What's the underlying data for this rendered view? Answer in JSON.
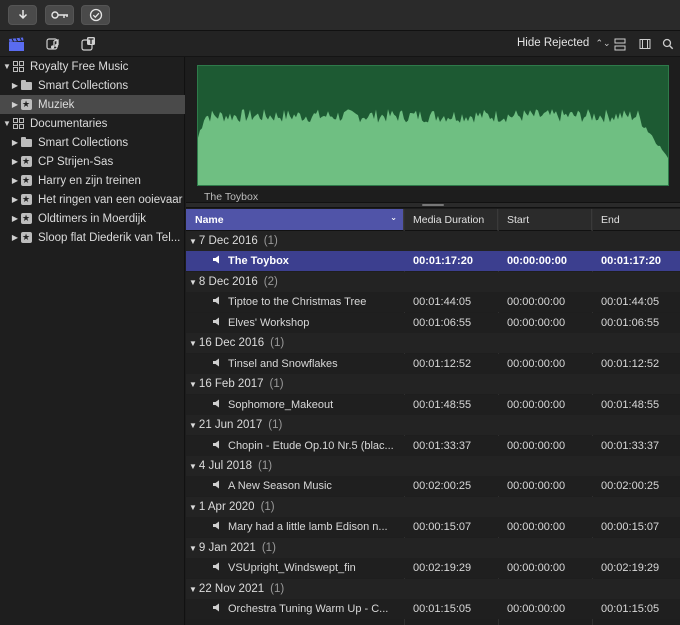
{
  "toolbar": {
    "buttons": [
      {
        "icon": "import-arrow-icon"
      },
      {
        "icon": "key-icon"
      },
      {
        "icon": "checkmark-circle-icon"
      }
    ]
  },
  "header": {
    "filter_label": "Hide Rejected"
  },
  "sidebar": {
    "items": [
      {
        "label": "Royalty Free Music",
        "level": 0,
        "expanded": true,
        "icon": "library-icon"
      },
      {
        "label": "Smart Collections",
        "level": 1,
        "expanded": false,
        "icon": "folder-icon"
      },
      {
        "label": "Muziek",
        "level": 1,
        "expanded": false,
        "icon": "event-star-icon",
        "selected": true
      },
      {
        "label": "Documentaries",
        "level": 0,
        "expanded": true,
        "icon": "library-icon"
      },
      {
        "label": "Smart Collections",
        "level": 1,
        "expanded": false,
        "icon": "folder-icon"
      },
      {
        "label": "CP Strijen-Sas",
        "level": 1,
        "expanded": false,
        "icon": "event-star-icon"
      },
      {
        "label": "Harry en zijn treinen",
        "level": 1,
        "expanded": false,
        "icon": "event-star-icon"
      },
      {
        "label": "Het ringen van een ooievaar",
        "level": 1,
        "expanded": false,
        "icon": "event-star-icon"
      },
      {
        "label": "Oldtimers in Moerdijk",
        "level": 1,
        "expanded": false,
        "icon": "event-star-icon"
      },
      {
        "label": "Sloop flat Diederik van Tel...",
        "level": 1,
        "expanded": false,
        "icon": "event-star-icon"
      }
    ]
  },
  "viewer": {
    "clip_label": "The Toybox",
    "wave_color": "#6fbf82"
  },
  "table": {
    "columns": [
      "Name",
      "Media Duration",
      "Start",
      "End"
    ],
    "groups": [
      {
        "date": "7 Dec 2016",
        "count": "(1)",
        "clips": [
          {
            "name": "The Toybox",
            "duration": "00:01:17:20",
            "start": "00:00:00:00",
            "end": "00:01:17:20",
            "selected": true
          }
        ]
      },
      {
        "date": "8 Dec 2016",
        "count": "(2)",
        "clips": [
          {
            "name": "Tiptoe to the Christmas Tree",
            "duration": "00:01:44:05",
            "start": "00:00:00:00",
            "end": "00:01:44:05"
          },
          {
            "name": "Elves' Workshop",
            "duration": "00:01:06:55",
            "start": "00:00:00:00",
            "end": "00:01:06:55"
          }
        ]
      },
      {
        "date": "16 Dec 2016",
        "count": "(1)",
        "clips": [
          {
            "name": "Tinsel and Snowflakes",
            "duration": "00:01:12:52",
            "start": "00:00:00:00",
            "end": "00:01:12:52"
          }
        ]
      },
      {
        "date": "16 Feb 2017",
        "count": "(1)",
        "clips": [
          {
            "name": "Sophomore_Makeout",
            "duration": "00:01:48:55",
            "start": "00:00:00:00",
            "end": "00:01:48:55"
          }
        ]
      },
      {
        "date": "21 Jun 2017",
        "count": "(1)",
        "clips": [
          {
            "name": "Chopin - Etude Op.10 Nr.5 (blac...",
            "duration": "00:01:33:37",
            "start": "00:00:00:00",
            "end": "00:01:33:37"
          }
        ]
      },
      {
        "date": "4 Jul 2018",
        "count": "(1)",
        "clips": [
          {
            "name": "A New Season Music",
            "duration": "00:02:00:25",
            "start": "00:00:00:00",
            "end": "00:02:00:25"
          }
        ]
      },
      {
        "date": "1 Apr 2020",
        "count": "(1)",
        "clips": [
          {
            "name": "Mary had a little lamb Edison n...",
            "duration": "00:00:15:07",
            "start": "00:00:00:00",
            "end": "00:00:15:07"
          }
        ]
      },
      {
        "date": "9 Jan 2021",
        "count": "(1)",
        "clips": [
          {
            "name": "VSUpright_Windswept_fin",
            "duration": "00:02:19:29",
            "start": "00:00:00:00",
            "end": "00:02:19:29"
          }
        ]
      },
      {
        "date": "22 Nov 2021",
        "count": "(1)",
        "clips": [
          {
            "name": "Orchestra Tuning  Warm Up - C...",
            "duration": "00:01:15:05",
            "start": "00:00:00:00",
            "end": "00:01:15:05"
          }
        ]
      }
    ]
  }
}
